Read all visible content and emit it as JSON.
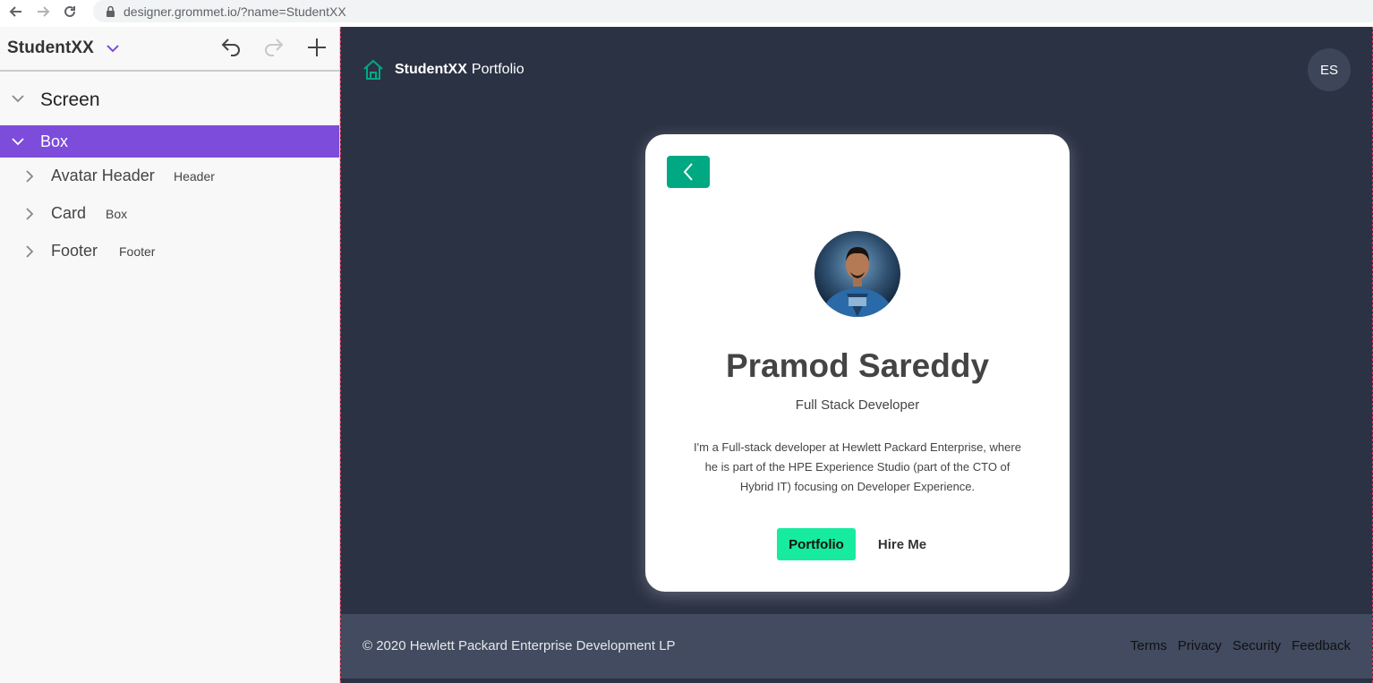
{
  "browser": {
    "url": "designer.grommet.io/?name=StudentXX"
  },
  "designer": {
    "app_name": "StudentXX",
    "tree": {
      "root": "Screen",
      "selected": "Box",
      "children": [
        {
          "label": "Avatar Header",
          "type": "Header"
        },
        {
          "label": "Card",
          "type": "Box"
        },
        {
          "label": "Footer",
          "type": "Footer"
        }
      ]
    }
  },
  "canvas": {
    "brand_title": "StudentXX",
    "brand_subtitle": "Portfolio",
    "user_initials": "ES",
    "card": {
      "name": "Pramod Sareddy",
      "role": "Full Stack Developer",
      "bio": "I'm a Full-stack developer at Hewlett Packard Enterprise, where he is part of the HPE Experience Studio (part of the CTO of Hybrid IT) focusing on Developer Experience.",
      "primary_button": "Portfolio",
      "secondary_button": "Hire Me"
    },
    "footer": {
      "copyright": "© 2020 Hewlett Packard Enterprise Development LP",
      "links": [
        "Terms",
        "Privacy",
        "Security",
        "Feedback"
      ]
    }
  },
  "colors": {
    "accent": "#7d4cdb",
    "brand_green": "#01a982",
    "button_green": "#17eba0",
    "canvas_bg": "#2b3244",
    "footer_bg": "#424b5f"
  }
}
